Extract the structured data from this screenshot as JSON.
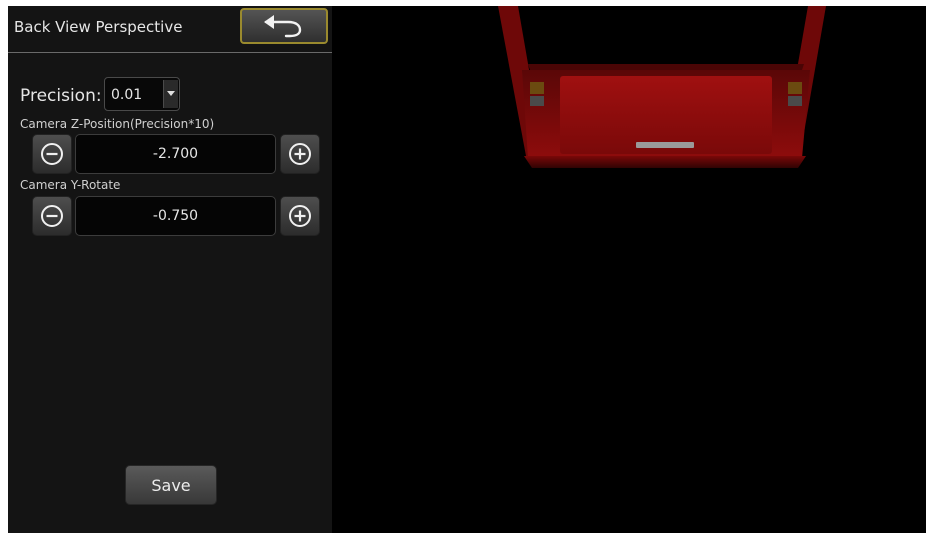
{
  "panel": {
    "title": "Back View Perspective",
    "back_icon": "arrow-back-return-icon"
  },
  "precision": {
    "label": "Precision:",
    "value": "0.01",
    "arrow_icon": "caret-down-icon"
  },
  "camera_z": {
    "label": "Camera  Z-Position(Precision*10)",
    "value": "-2.700",
    "decrement_icon": "minus-circle-icon",
    "increment_icon": "plus-circle-icon"
  },
  "camera_y": {
    "label": "Camera Y-Rotate",
    "value": "-0.750",
    "decrement_icon": "minus-circle-icon",
    "increment_icon": "plus-circle-icon"
  },
  "save_label": "Save",
  "colors": {
    "panel_bg": "#141414",
    "back_button_border": "#9a8a2e",
    "vehicle_red": "#8e0c0c",
    "viewport_bg": "#000000"
  }
}
